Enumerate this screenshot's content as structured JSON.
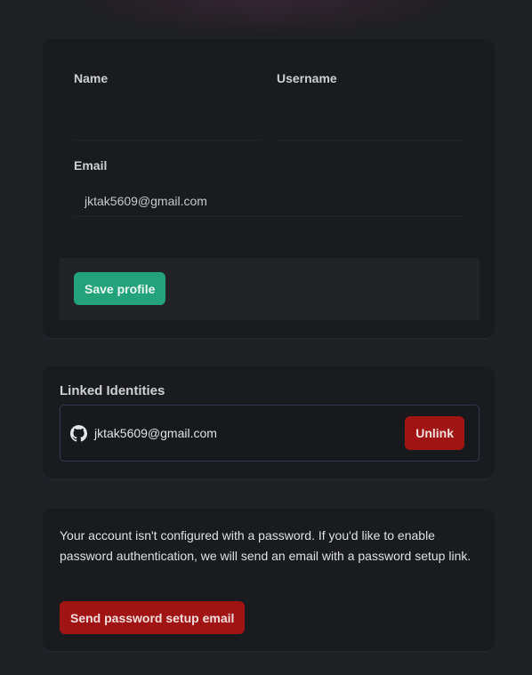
{
  "profile": {
    "name_label": "Name",
    "name_value": "",
    "username_label": "Username",
    "username_value": "",
    "email_label": "Email",
    "email_value": "jktak5609@gmail.com",
    "save_label": "Save profile"
  },
  "identities": {
    "title": "Linked Identities",
    "items": [
      {
        "provider_icon": "github-icon",
        "email": "jktak5609@gmail.com",
        "action_label": "Unlink"
      }
    ]
  },
  "password": {
    "message": "Your account isn't configured with a password. If you'd like to enable password authentication, we will send an email with a password setup link.",
    "button_label": "Send password setup email"
  },
  "colors": {
    "accent_green": "#24a37b",
    "danger_red": "#a01414",
    "background": "#1f2023",
    "card": "#1a1b1e"
  }
}
